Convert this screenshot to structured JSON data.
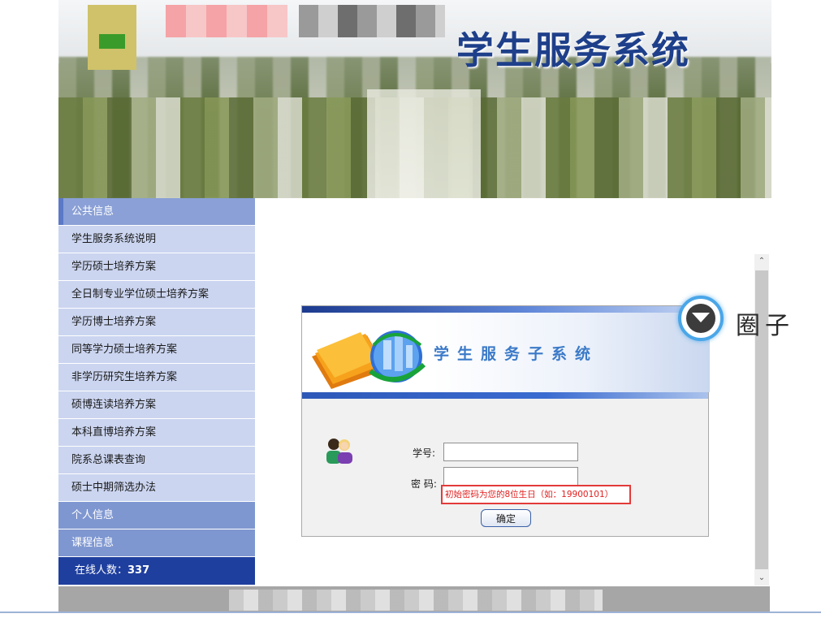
{
  "banner": {
    "title": "学生服务系统"
  },
  "sidebar": {
    "public_info": "公共信息",
    "items": [
      {
        "label": "学生服务系统说明"
      },
      {
        "label": "学历硕士培养方案"
      },
      {
        "label": "全日制专业学位硕士培养方案"
      },
      {
        "label": "学历博士培养方案"
      },
      {
        "label": "同等学力硕士培养方案"
      },
      {
        "label": "非学历研究生培养方案"
      },
      {
        "label": "硕博连读培养方案"
      },
      {
        "label": "本科直博培养方案"
      },
      {
        "label": "院系总课表查询"
      },
      {
        "label": "硕士中期筛选办法"
      }
    ],
    "personal_info": "个人信息",
    "course_info": "课程信息",
    "online_label": "在线人数：",
    "online_count": "337"
  },
  "login": {
    "title": "学生服务子系统",
    "student_id_label": "学号:",
    "password_label": "密 码:",
    "student_id_value": "",
    "password_value": "",
    "hint": "初始密码为您的8位生日（如：19900101）",
    "confirm_label": "确定"
  },
  "watermark": {
    "text": "圈子"
  },
  "scrollbar": {
    "up_icon": "chevron-up-icon",
    "down_icon": "chevron-down-icon"
  },
  "colors": {
    "sidebar_header": "#7f97d1",
    "sidebar_item": "#cbd5f0",
    "online_bg": "#1f3f9e",
    "banner_title": "#1e3f8a",
    "login_title": "#3b7ac8",
    "hint_red": "#e02020"
  }
}
